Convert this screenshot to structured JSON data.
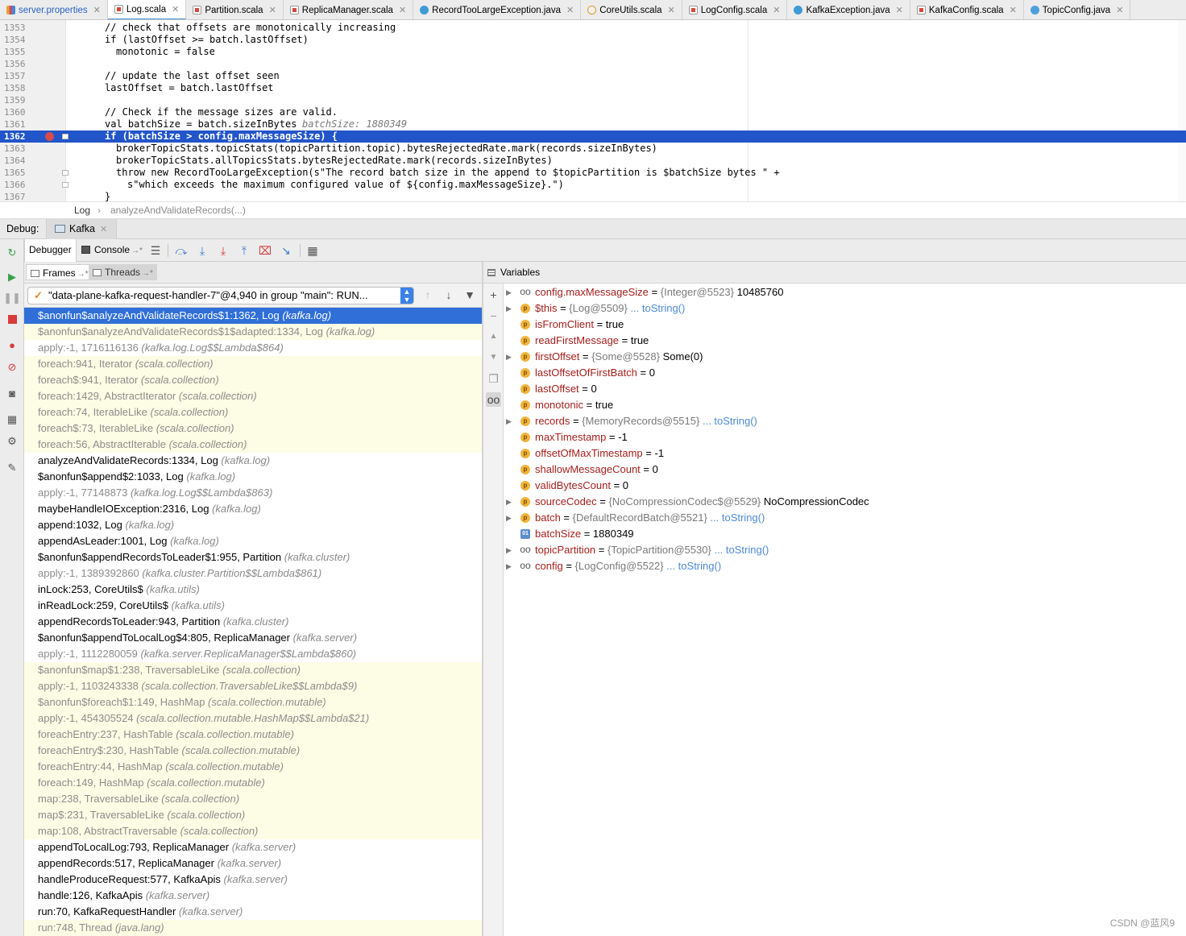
{
  "tabs": [
    {
      "label": "server.properties",
      "icon": "properties-file-icon",
      "active": false
    },
    {
      "label": "Log.scala",
      "icon": "scala-file-icon",
      "active": true
    },
    {
      "label": "Partition.scala",
      "icon": "scala-file-icon",
      "active": false
    },
    {
      "label": "ReplicaManager.scala",
      "icon": "scala-file-icon",
      "active": false
    },
    {
      "label": "RecordTooLargeException.java",
      "icon": "java-file-icon",
      "active": false
    },
    {
      "label": "CoreUtils.scala",
      "icon": "scala-object-icon",
      "active": false
    },
    {
      "label": "LogConfig.scala",
      "icon": "scala-file-icon",
      "active": false
    },
    {
      "label": "KafkaException.java",
      "icon": "java-file-icon",
      "active": false
    },
    {
      "label": "KafkaConfig.scala",
      "icon": "scala-file-icon",
      "active": false
    },
    {
      "label": "TopicConfig.java",
      "icon": "java-class-icon",
      "active": false
    }
  ],
  "editor": {
    "lines": [
      {
        "num": "1353",
        "code": "// check that offsets are monotonically increasing"
      },
      {
        "num": "1354",
        "code": "if (lastOffset >= batch.lastOffset)"
      },
      {
        "num": "1355",
        "code": "  monotonic = false"
      },
      {
        "num": "1356",
        "code": ""
      },
      {
        "num": "1357",
        "code": "// update the last offset seen"
      },
      {
        "num": "1358",
        "code": "lastOffset = batch.lastOffset"
      },
      {
        "num": "1359",
        "code": ""
      },
      {
        "num": "1360",
        "code": "// Check if the message sizes are valid."
      },
      {
        "num": "1361",
        "code": "val batchSize = batch.sizeInBytes",
        "inlay": "batchSize: 1880349"
      },
      {
        "num": "1362",
        "code": "if (batchSize > config.maxMessageSize) {",
        "exec": true
      },
      {
        "num": "1363",
        "code": "  brokerTopicStats.topicStats(topicPartition.topic).bytesRejectedRate.mark(records.sizeInBytes)"
      },
      {
        "num": "1364",
        "code": "  brokerTopicStats.allTopicsStats.bytesRejectedRate.mark(records.sizeInBytes)"
      },
      {
        "num": "1365",
        "code": "  throw new RecordTooLargeException(s\"The record batch size in the append to $topicPartition is $batchSize bytes \" +"
      },
      {
        "num": "1366",
        "code": "    s\"which exceeds the maximum configured value of ${config.maxMessageSize}.\")"
      },
      {
        "num": "1367",
        "code": "}"
      }
    ]
  },
  "breadcrumb": {
    "class": "Log",
    "method": "analyzeAndValidateRecords(...)"
  },
  "debug": {
    "label": "Debug:",
    "session": "Kafka",
    "tabs": {
      "debugger": "Debugger",
      "console": "Console"
    },
    "frames_tab": "Frames",
    "threads_tab": "Threads",
    "variables_title": "Variables",
    "thread": "\"data-plane-kafka-request-handler-7\"@4,940 in group \"main\": RUN..."
  },
  "frames": [
    {
      "text": "$anonfun$analyzeAndValidateRecords$1:1362, Log ",
      "pkg": "(kafka.log)",
      "kind": "sel"
    },
    {
      "text": "$anonfun$analyzeAndValidateRecords$1$adapted:1334, Log ",
      "pkg": "(kafka.log)",
      "kind": "lib"
    },
    {
      "text": "apply:-1, 1716116136 ",
      "pkg": "(kafka.log.Log$$Lambda$864)",
      "kind": "dim"
    },
    {
      "text": "foreach:941, Iterator ",
      "pkg": "(scala.collection)",
      "kind": "lib"
    },
    {
      "text": "foreach$:941, Iterator ",
      "pkg": "(scala.collection)",
      "kind": "lib"
    },
    {
      "text": "foreach:1429, AbstractIterator ",
      "pkg": "(scala.collection)",
      "kind": "lib"
    },
    {
      "text": "foreach:74, IterableLike ",
      "pkg": "(scala.collection)",
      "kind": "lib"
    },
    {
      "text": "foreach$:73, IterableLike ",
      "pkg": "(scala.collection)",
      "kind": "lib"
    },
    {
      "text": "foreach:56, AbstractIterable ",
      "pkg": "(scala.collection)",
      "kind": "lib"
    },
    {
      "text": "analyzeAndValidateRecords:1334, Log ",
      "pkg": "(kafka.log)",
      "kind": "normal"
    },
    {
      "text": "$anonfun$append$2:1033, Log ",
      "pkg": "(kafka.log)",
      "kind": "normal"
    },
    {
      "text": "apply:-1, 77148873 ",
      "pkg": "(kafka.log.Log$$Lambda$863)",
      "kind": "dim"
    },
    {
      "text": "maybeHandleIOException:2316, Log ",
      "pkg": "(kafka.log)",
      "kind": "normal"
    },
    {
      "text": "append:1032, Log ",
      "pkg": "(kafka.log)",
      "kind": "normal"
    },
    {
      "text": "appendAsLeader:1001, Log ",
      "pkg": "(kafka.log)",
      "kind": "normal"
    },
    {
      "text": "$anonfun$appendRecordsToLeader$1:955, Partition ",
      "pkg": "(kafka.cluster)",
      "kind": "normal"
    },
    {
      "text": "apply:-1, 1389392860 ",
      "pkg": "(kafka.cluster.Partition$$Lambda$861)",
      "kind": "dim"
    },
    {
      "text": "inLock:253, CoreUtils$ ",
      "pkg": "(kafka.utils)",
      "kind": "normal"
    },
    {
      "text": "inReadLock:259, CoreUtils$ ",
      "pkg": "(kafka.utils)",
      "kind": "normal"
    },
    {
      "text": "appendRecordsToLeader:943, Partition ",
      "pkg": "(kafka.cluster)",
      "kind": "normal"
    },
    {
      "text": "$anonfun$appendToLocalLog$4:805, ReplicaManager ",
      "pkg": "(kafka.server)",
      "kind": "normal"
    },
    {
      "text": "apply:-1, 1112280059 ",
      "pkg": "(kafka.server.ReplicaManager$$Lambda$860)",
      "kind": "dim"
    },
    {
      "text": "$anonfun$map$1:238, TraversableLike ",
      "pkg": "(scala.collection)",
      "kind": "lib"
    },
    {
      "text": "apply:-1, 1103243338 ",
      "pkg": "(scala.collection.TraversableLike$$Lambda$9)",
      "kind": "lib"
    },
    {
      "text": "$anonfun$foreach$1:149, HashMap ",
      "pkg": "(scala.collection.mutable)",
      "kind": "lib"
    },
    {
      "text": "apply:-1, 454305524 ",
      "pkg": "(scala.collection.mutable.HashMap$$Lambda$21)",
      "kind": "lib"
    },
    {
      "text": "foreachEntry:237, HashTable ",
      "pkg": "(scala.collection.mutable)",
      "kind": "lib"
    },
    {
      "text": "foreachEntry$:230, HashTable ",
      "pkg": "(scala.collection.mutable)",
      "kind": "lib"
    },
    {
      "text": "foreachEntry:44, HashMap ",
      "pkg": "(scala.collection.mutable)",
      "kind": "lib"
    },
    {
      "text": "foreach:149, HashMap ",
      "pkg": "(scala.collection.mutable)",
      "kind": "lib"
    },
    {
      "text": "map:238, TraversableLike ",
      "pkg": "(scala.collection)",
      "kind": "lib"
    },
    {
      "text": "map$:231, TraversableLike ",
      "pkg": "(scala.collection)",
      "kind": "lib"
    },
    {
      "text": "map:108, AbstractTraversable ",
      "pkg": "(scala.collection)",
      "kind": "lib"
    },
    {
      "text": "appendToLocalLog:793, ReplicaManager ",
      "pkg": "(kafka.server)",
      "kind": "normal"
    },
    {
      "text": "appendRecords:517, ReplicaManager ",
      "pkg": "(kafka.server)",
      "kind": "normal"
    },
    {
      "text": "handleProduceRequest:577, KafkaApis ",
      "pkg": "(kafka.server)",
      "kind": "normal"
    },
    {
      "text": "handle:126, KafkaApis ",
      "pkg": "(kafka.server)",
      "kind": "normal"
    },
    {
      "text": "run:70, KafkaRequestHandler ",
      "pkg": "(kafka.server)",
      "kind": "normal"
    },
    {
      "text": "run:748, Thread ",
      "pkg": "(java.lang)",
      "kind": "lib"
    }
  ],
  "variables": [
    {
      "expandable": true,
      "icon": "watch",
      "name": "config.maxMessageSize",
      "ref": "{Integer@5523}",
      "value": "10485760",
      "link": ""
    },
    {
      "expandable": true,
      "icon": "p",
      "name": "$this",
      "ref": "{Log@5509}",
      "value": "",
      "link": "... toString()"
    },
    {
      "expandable": false,
      "icon": "p",
      "name": "isFromClient",
      "ref": "",
      "value": "true",
      "link": ""
    },
    {
      "expandable": false,
      "icon": "p",
      "name": "readFirstMessage",
      "ref": "",
      "value": "true",
      "link": ""
    },
    {
      "expandable": true,
      "icon": "p",
      "name": "firstOffset",
      "ref": "{Some@5528}",
      "value": "Some(0)",
      "link": ""
    },
    {
      "expandable": false,
      "icon": "p",
      "name": "lastOffsetOfFirstBatch",
      "ref": "",
      "value": "0",
      "link": ""
    },
    {
      "expandable": false,
      "icon": "p",
      "name": "lastOffset",
      "ref": "",
      "value": "0",
      "link": ""
    },
    {
      "expandable": false,
      "icon": "p",
      "name": "monotonic",
      "ref": "",
      "value": "true",
      "link": ""
    },
    {
      "expandable": true,
      "icon": "p",
      "name": "records",
      "ref": "{MemoryRecords@5515}",
      "value": "",
      "link": "... toString()"
    },
    {
      "expandable": false,
      "icon": "p",
      "name": "maxTimestamp",
      "ref": "",
      "value": "-1",
      "link": ""
    },
    {
      "expandable": false,
      "icon": "p",
      "name": "offsetOfMaxTimestamp",
      "ref": "",
      "value": "-1",
      "link": ""
    },
    {
      "expandable": false,
      "icon": "p",
      "name": "shallowMessageCount",
      "ref": "",
      "value": "0",
      "link": ""
    },
    {
      "expandable": false,
      "icon": "p",
      "name": "validBytesCount",
      "ref": "",
      "value": "0",
      "link": ""
    },
    {
      "expandable": true,
      "icon": "p",
      "name": "sourceCodec",
      "ref": "{NoCompressionCodec$@5529}",
      "value": "NoCompressionCodec",
      "link": ""
    },
    {
      "expandable": true,
      "icon": "p",
      "name": "batch",
      "ref": "{DefaultRecordBatch@5521}",
      "value": "",
      "link": "... toString()"
    },
    {
      "expandable": false,
      "icon": "binary",
      "name": "batchSize",
      "ref": "",
      "value": "1880349",
      "link": ""
    },
    {
      "expandable": true,
      "icon": "watch",
      "name": "topicPartition",
      "ref": "{TopicPartition@5530}",
      "value": "",
      "link": "... toString()"
    },
    {
      "expandable": true,
      "icon": "watch",
      "name": "config",
      "ref": "{LogConfig@5522}",
      "value": "",
      "link": "... toString()"
    }
  ],
  "watermark": "CSDN @蓝风9"
}
